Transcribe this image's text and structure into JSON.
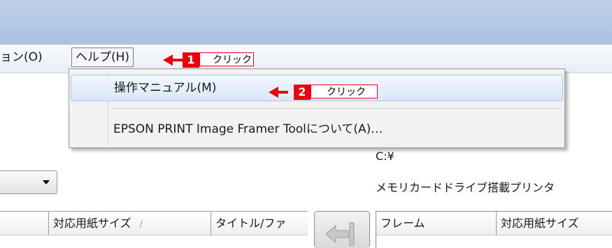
{
  "menubar": {
    "option_label": "ョン(O)",
    "help_label": "ヘルプ(H)"
  },
  "help_menu": {
    "items": [
      {
        "label": "操作マニュアル(M)"
      },
      {
        "label": "EPSON PRINT Image Framer Toolについて(A)…"
      }
    ]
  },
  "callouts": [
    {
      "number": "1",
      "text": "クリック"
    },
    {
      "number": "2",
      "text": "クリック"
    }
  ],
  "info": {
    "path": "C:¥",
    "printer_type": "メモリカードドライブ搭載プリンタ"
  },
  "left_list": {
    "columns": [
      "対応用紙サイズ",
      "タイトル/ファ"
    ],
    "sort_mark": "/"
  },
  "right_list": {
    "columns": [
      "フレーム",
      "対応用紙サイズ"
    ]
  },
  "colors": {
    "accent": "#e60012",
    "title_bar": "#b4c9e5",
    "highlight": "#d9e8f8"
  }
}
